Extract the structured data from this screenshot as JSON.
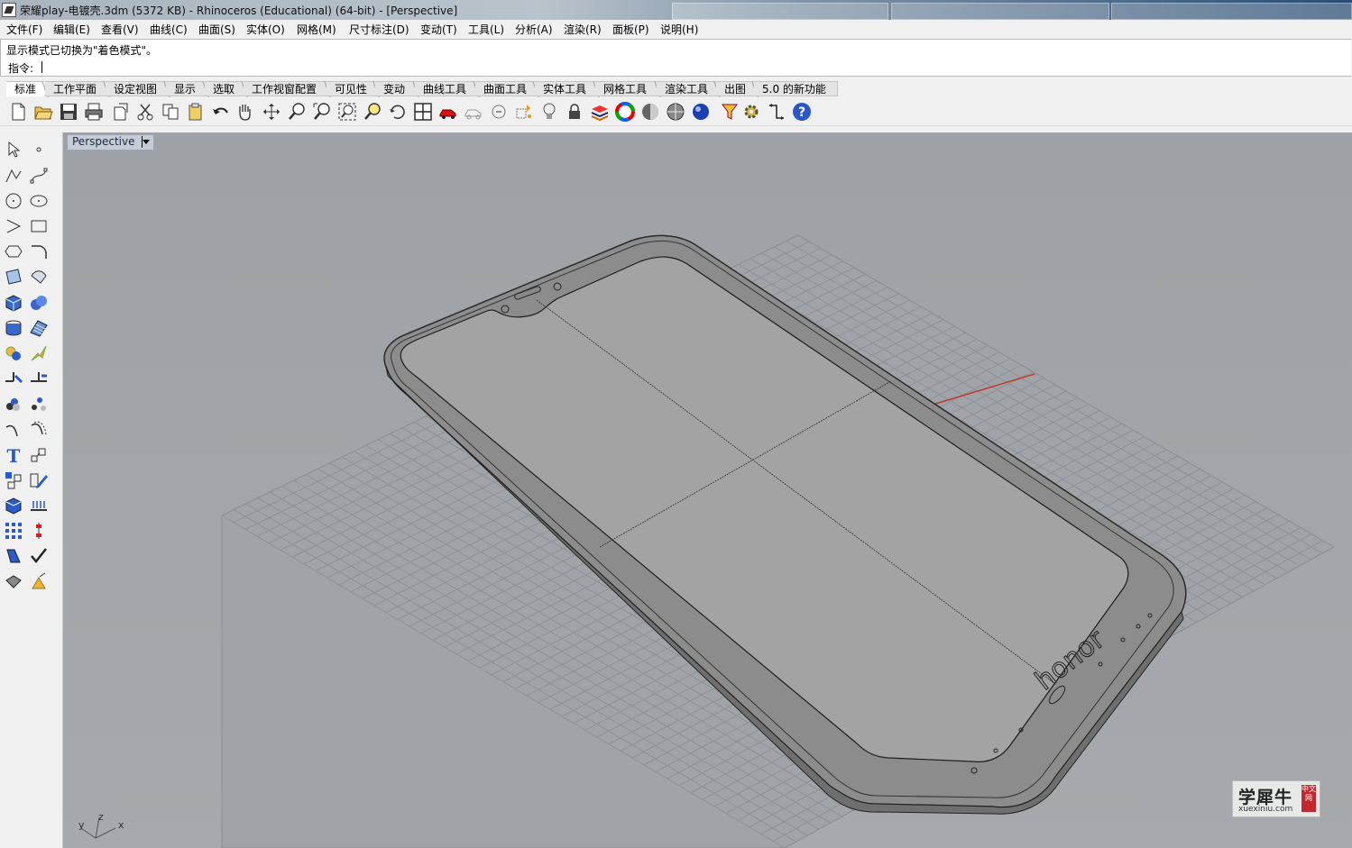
{
  "window": {
    "title": "荣耀play-电镀壳.3dm (5372 KB) - Rhinoceros (Educational) (64-bit) - [Perspective]"
  },
  "menu": [
    "文件(F)",
    "编辑(E)",
    "查看(V)",
    "曲线(C)",
    "曲面(S)",
    "实体(O)",
    "网格(M)",
    "尺寸标注(D)",
    "变动(T)",
    "工具(L)",
    "分析(A)",
    "渲染(R)",
    "面板(P)",
    "说明(H)"
  ],
  "command": {
    "history": "显示模式已切换为\"着色模式\"。",
    "prompt_label": "指令:"
  },
  "toolbar_tabs": [
    "标准",
    "工作平面",
    "设定视图",
    "显示",
    "选取",
    "工作视窗配置",
    "可见性",
    "变动",
    "曲线工具",
    "曲面工具",
    "实体工具",
    "网格工具",
    "渲染工具",
    "出图",
    "5.0 的新功能"
  ],
  "toolbar_icons": [
    "new-file-icon",
    "open-file-icon",
    "save-icon",
    "print-icon",
    "import-icon",
    "cut-icon",
    "copy-icon",
    "paste-icon",
    "undo-icon",
    "pan-hand-icon",
    "move-view-icon",
    "zoom-window-icon",
    "zoom-dynamic-icon",
    "zoom-extents-icon",
    "zoom-selected-icon",
    "rotate-view-icon",
    "four-viewports-icon",
    "car-model-icon",
    "wireframe-car-icon",
    "point-on-icon",
    "snap-points-icon",
    "light-bulb-icon",
    "lock-icon",
    "layer-icon",
    "color-wheel-icon",
    "shaded-sphere-icon",
    "rendered-sphere-icon",
    "blue-sphere-icon",
    "filter-icon",
    "settings-gear-icon",
    "dimension-icon",
    "help-icon"
  ],
  "viewport": {
    "name": "Perspective",
    "logo_text": "honor",
    "axes": [
      "z",
      "y",
      "x"
    ]
  },
  "watermark": {
    "big": "学犀牛",
    "small": "xuexiniu.com",
    "badge": "中文网"
  },
  "colors": {
    "viewport_bg": "#a3a6aa",
    "grid": "#8e9196",
    "phone_fill": "#9c9c9c",
    "x_axis": "#c0392b"
  }
}
